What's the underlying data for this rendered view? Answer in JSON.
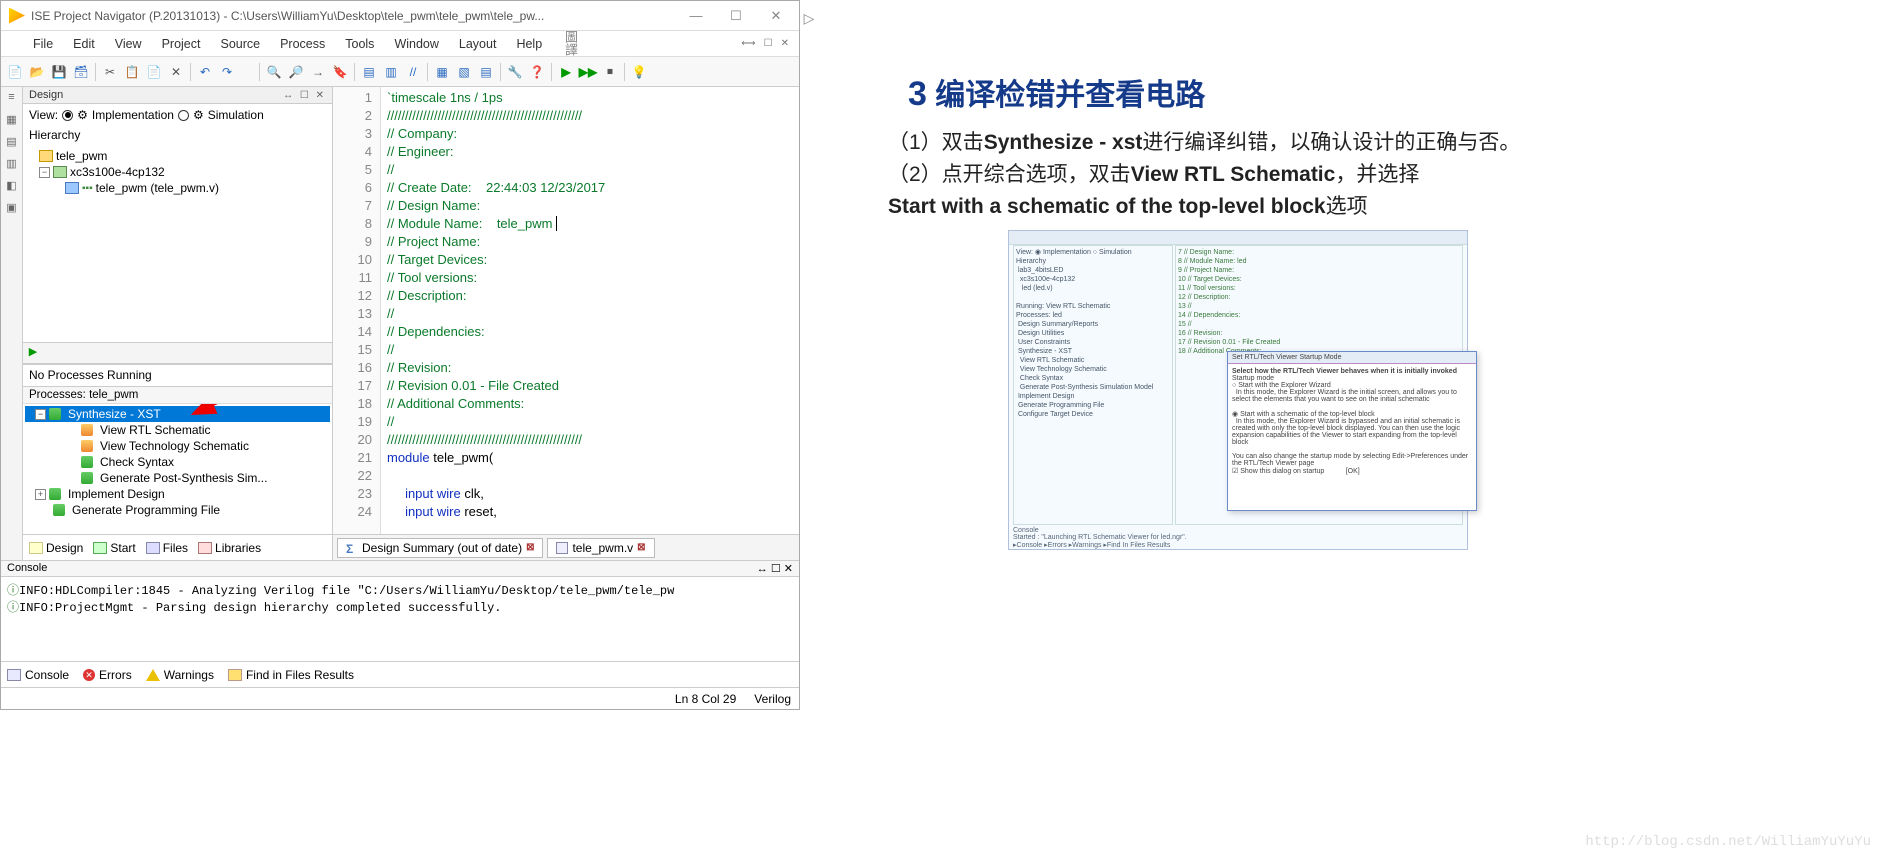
{
  "window": {
    "title": "ISE Project Navigator (P.20131013) - C:\\Users\\WilliamYu\\Desktop\\tele_pwm\\tele_pwm\\tele_pw..."
  },
  "menus": [
    "File",
    "Edit",
    "View",
    "Project",
    "Source",
    "Process",
    "Tools",
    "Window",
    "Layout",
    "Help"
  ],
  "design": {
    "panel_title": "Design",
    "view_label": "View:",
    "impl_label": "Implementation",
    "sim_label": "Simulation",
    "hierarchy_label": "Hierarchy",
    "tree": {
      "project": "tele_pwm",
      "device": "xc3s100e-4cp132",
      "module": "tele_pwm (tele_pwm.v)"
    }
  },
  "processes": {
    "status": "No Processes Running",
    "header": "Processes: tele_pwm",
    "items": [
      "Synthesize - XST",
      "View RTL Schematic",
      "View Technology Schematic",
      "Check Syntax",
      "Generate Post-Synthesis Sim...",
      "Implement Design",
      "Generate Programming File"
    ]
  },
  "bottom_tabs": {
    "design": "Design",
    "start": "Start",
    "files": "Files",
    "libraries": "Libraries"
  },
  "editor_tabs": {
    "summary": "Design Summary (out of date)",
    "file": "tele_pwm.v"
  },
  "code": {
    "lines": [
      "`timescale 1ns / 1ps",
      "//////////////////////////////////////////////////////",
      "// Company:",
      "// Engineer:",
      "//",
      "// Create Date:    22:44:03 12/23/2017",
      "// Design Name:",
      "// Module Name:    tele_pwm ",
      "// Project Name:",
      "// Target Devices:",
      "// Tool versions:",
      "// Description:",
      "//",
      "// Dependencies:",
      "//",
      "// Revision:",
      "// Revision 0.01 - File Created",
      "// Additional Comments:",
      "//",
      "//////////////////////////////////////////////////////",
      "module tele_pwm(",
      "",
      "     input wire clk,",
      "     input wire reset,"
    ]
  },
  "console": {
    "header": "Console",
    "lines": [
      "INFO:HDLCompiler:1845 - Analyzing Verilog file \"C:/Users/WilliamYu/Desktop/tele_pwm/tele_pw",
      "INFO:ProjectMgmt - Parsing design hierarchy completed successfully."
    ]
  },
  "console_tabs": {
    "console": "Console",
    "errors": "Errors",
    "warnings": "Warnings",
    "find": "Find in Files Results"
  },
  "statusbar": {
    "pos": "Ln 8 Col 29",
    "lang": "Verilog"
  },
  "divider_label": "圖譯",
  "right": {
    "title_num": "3",
    "title_text": " 编译检错并查看电路",
    "p1a": "（1）双击",
    "p1b": "Synthesize - xst",
    "p1c": "进行编译纠错，以确认设计的正确与否。",
    "p2a": "（2）点开综合选项，双击",
    "p2b": "View RTL Schematic",
    "p2c": "，并选择",
    "p3": "Start with a schematic of the top-level block",
    "p3b": "选项",
    "watermark": "http://blog.csdn.net/WilliamYuYuYu",
    "thumb_dialog_title": "Set RTL/Tech Viewer Startup Mode",
    "thumb_dialog_line1": "Select how the RTL/Tech Viewer behaves when it is initially invoked",
    "thumb_dialog_opt1": "Start with the Explorer Wizard",
    "thumb_dialog_opt2": "Start with a schematic of the top-level block",
    "thumb_dialog_show": "Show this dialog on startup",
    "thumb_running": "Running: View RTL Schematic",
    "thumb_started": "Started : \"Launching RTL Schematic Viewer for led.ngr\"."
  }
}
